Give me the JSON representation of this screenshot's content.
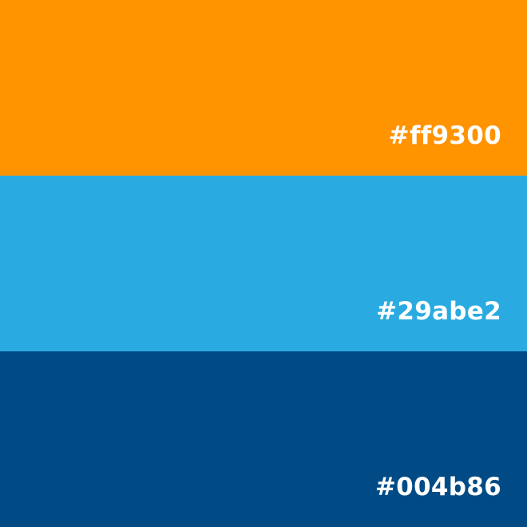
{
  "palette": {
    "swatches": [
      {
        "color": "#ff9300",
        "label": "#ff9300"
      },
      {
        "color": "#29abe2",
        "label": "#29abe2"
      },
      {
        "color": "#004b86",
        "label": "#004b86"
      }
    ]
  }
}
